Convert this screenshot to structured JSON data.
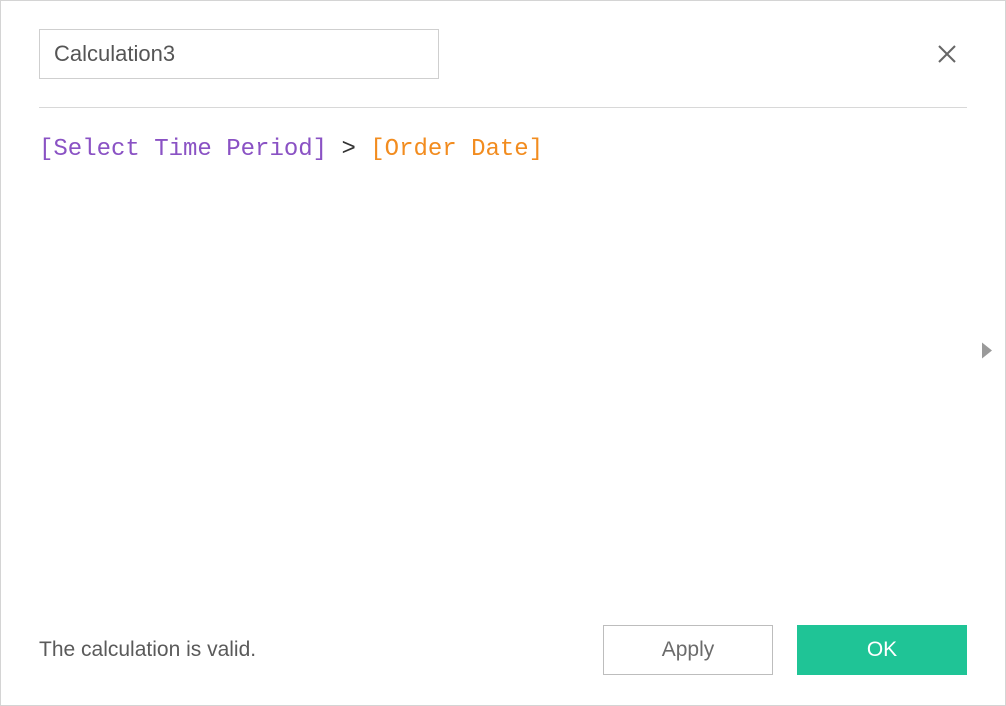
{
  "dialog": {
    "calculation_name": "Calculation3",
    "status_message": "The calculation is valid.",
    "apply_label": "Apply",
    "ok_label": "OK"
  },
  "formula": {
    "token_param": "[Select Time Period]",
    "token_operator": ">",
    "token_field": "[Order Date]"
  }
}
